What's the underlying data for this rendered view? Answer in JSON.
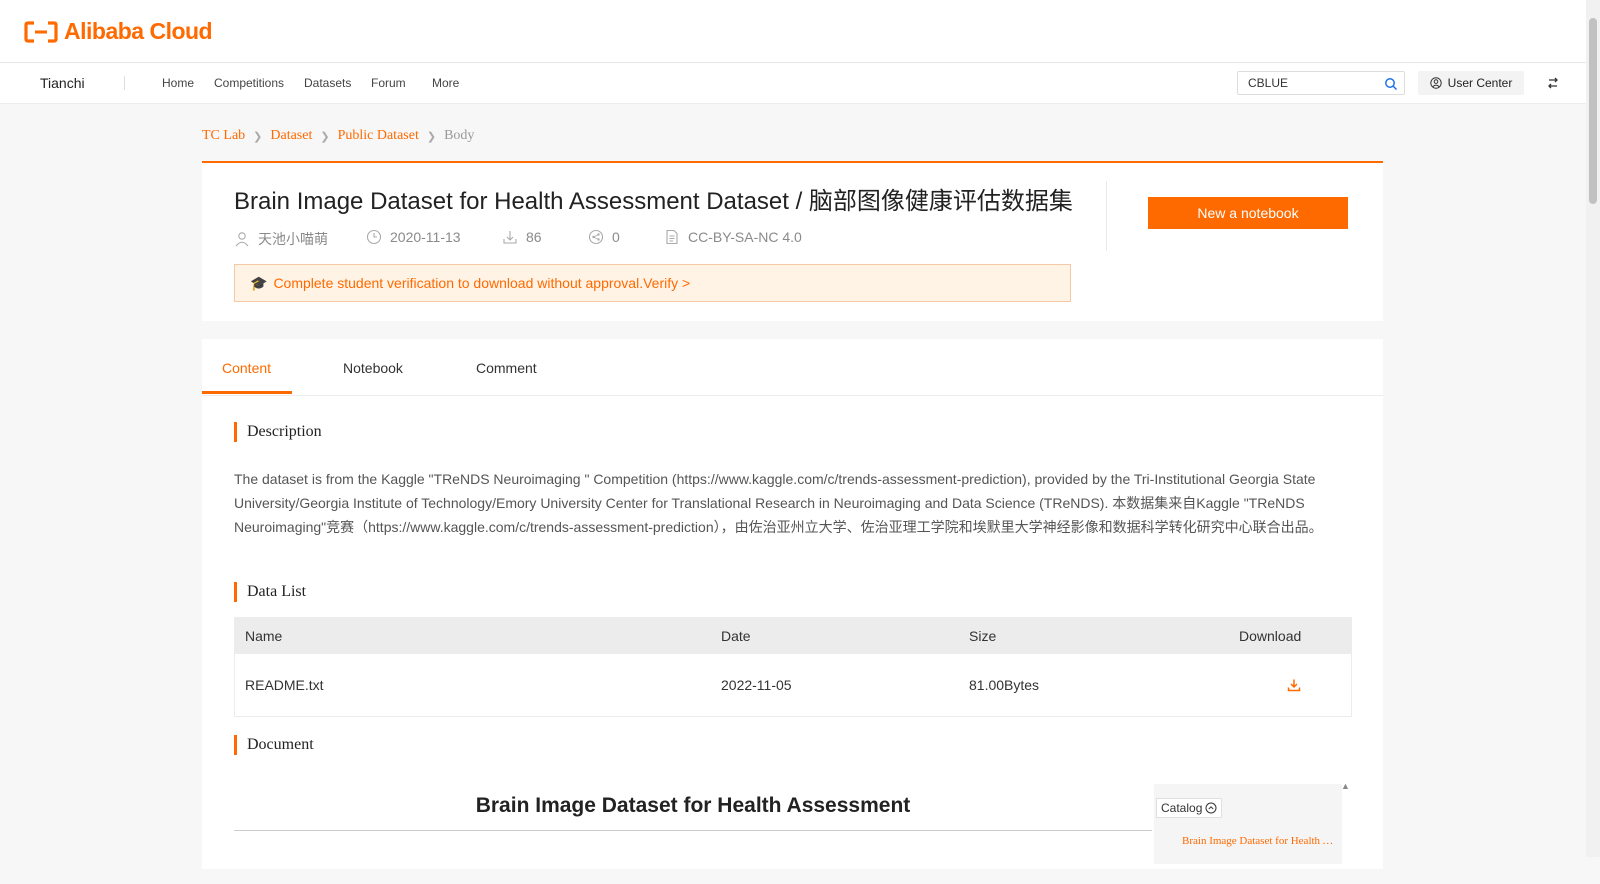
{
  "header": {
    "logo_text": "Alibaba Cloud"
  },
  "nav": {
    "brand": "Tianchi",
    "links": [
      "Home",
      "Competitions",
      "Datasets",
      "Forum",
      "More"
    ],
    "search_value": "CBLUE",
    "user_center": "User Center"
  },
  "breadcrumb": [
    "TC Lab",
    "Dataset",
    "Public Dataset",
    "Body"
  ],
  "dataset": {
    "title": "Brain Image Dataset for Health Assessment Dataset / 脑部图像健康评估数据集",
    "author": "天池小喵萌",
    "date": "2020-11-13",
    "downloads": "86",
    "shares": "0",
    "license": "CC-BY-SA-NC 4.0",
    "notice": "Complete student verification to download without approval.Verify >",
    "new_notebook": "New a notebook"
  },
  "tabs": [
    "Content",
    "Notebook",
    "Comment"
  ],
  "sections": {
    "description_title": "Description",
    "description_text": "The dataset is from the Kaggle \"TReNDS Neuroimaging \" Competition (https://www.kaggle.com/c/trends-assessment-prediction), provided by the Tri-Institutional Georgia State University/Georgia Institute of Technology/Emory University Center for Translational Research in Neuroimaging and Data Science (TReNDS). 本数据集来自Kaggle \"TReNDS Neuroimaging\"竞赛（https://www.kaggle.com/c/trends-assessment-prediction），由佐治亚州立大学、佐治亚理工学院和埃默里大学神经影像和数据科学转化研究中心联合出品。",
    "datalist_title": "Data List",
    "document_title": "Document"
  },
  "table": {
    "headers": [
      "Name",
      "Date",
      "Size",
      "Download"
    ],
    "rows": [
      {
        "name": "README.txt",
        "date": "2022-11-05",
        "size": "81.00Bytes"
      }
    ]
  },
  "document": {
    "heading": "Brain Image Dataset for Health Assessment",
    "catalog_label": "Catalog",
    "catalog_item": "Brain Image Dataset for Health Assessment"
  },
  "colors": {
    "accent": "#ff6a00",
    "notice_bg": "#fff3e6"
  }
}
